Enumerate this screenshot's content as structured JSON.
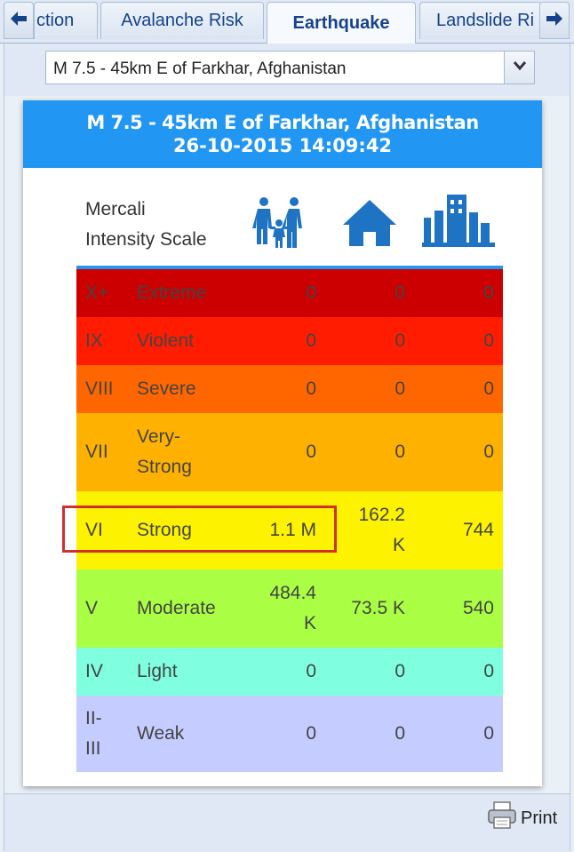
{
  "tabs": [
    {
      "label": "ction"
    },
    {
      "label": "Avalanche Risk"
    },
    {
      "label": "Earthquake"
    },
    {
      "label": "Landslide Ri"
    }
  ],
  "event_select": {
    "value": "M 7.5 - 45km E of Farkhar, Afghanistan"
  },
  "card": {
    "title": "M 7.5 - 45km E of Farkhar, Afghanistan",
    "datetime": "26-10-2015 14:09:42",
    "scale_label_line1": "Mercali",
    "scale_label_line2": "Intensity Scale",
    "columns": [
      "people-icon",
      "house-icon",
      "buildings-icon"
    ]
  },
  "rows": [
    {
      "level": "X+",
      "name": "Extreme",
      "people": "0",
      "houses": "0",
      "buildings": "0",
      "color": "#cc0000"
    },
    {
      "level": "IX",
      "name": "Violent",
      "people": "0",
      "houses": "0",
      "buildings": "0",
      "color": "#ff1c00"
    },
    {
      "level": "VIII",
      "name": "Severe",
      "people": "0",
      "houses": "0",
      "buildings": "0",
      "color": "#ff6600"
    },
    {
      "level": "VII",
      "name": "Very-\nStrong",
      "people": "0",
      "houses": "0",
      "buildings": "0",
      "color": "#ffb100"
    },
    {
      "level": "VI",
      "name": "Strong",
      "people": "1.1 M",
      "houses": "162.2\nK",
      "buildings": "744",
      "color": "#fdf200"
    },
    {
      "level": "V",
      "name": "Moderate",
      "people": "484.4\nK",
      "houses": "73.5 K",
      "buildings": "540",
      "color": "#aaff44"
    },
    {
      "level": "IV",
      "name": "Light",
      "people": "0",
      "houses": "0",
      "buildings": "0",
      "color": "#7fffdf"
    },
    {
      "level": "II-\nIII",
      "name": "Weak",
      "people": "0",
      "houses": "0",
      "buildings": "0",
      "color": "#c5ccff"
    }
  ],
  "footer": {
    "print_label": "Print"
  }
}
